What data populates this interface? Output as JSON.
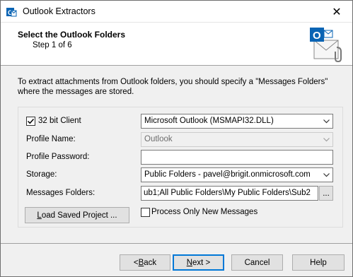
{
  "window": {
    "title": "Outlook Extractors",
    "app_icon": "outlook-extractor-icon",
    "close_glyph": "✕"
  },
  "header": {
    "title": "Select the Outlook Folders",
    "subtitle": "Step 1 of 6",
    "logo": "outlook-mail-logo"
  },
  "description": "To extract attachments from Outlook folders, you should specify a \"Messages Folders\" where the messages are stored.",
  "form": {
    "client_checkbox": {
      "label": "32 bit Client",
      "checked": true
    },
    "client_select": {
      "value": "Microsoft Outlook (MSMAPI32.DLL)"
    },
    "profile_name": {
      "label": "Profile Name:",
      "value": "Outlook"
    },
    "profile_password": {
      "label": "Profile Password:",
      "value": ""
    },
    "storage": {
      "label": "Storage:",
      "value": "Public Folders - pavel@brigit.onmicrosoft.com"
    },
    "messages_folders": {
      "label": "Messages Folders:",
      "value": "ub1;All Public Folders\\My Public Folders\\Sub2",
      "browse_label": "..."
    },
    "load_button": {
      "label": "Load Saved Project ...",
      "accel": "L",
      "rest": "oad Saved Project ..."
    },
    "process_new": {
      "label": "Process Only New Messages",
      "checked": false
    }
  },
  "footer": {
    "back": {
      "prefix": "< ",
      "accel": "B",
      "rest": "ack"
    },
    "next": {
      "accel": "N",
      "rest": "ext >"
    },
    "cancel": {
      "label": "Cancel"
    },
    "help": {
      "label": "Help"
    }
  },
  "colors": {
    "accent": "#0078d7",
    "outlook_blue": "#0a64b4"
  }
}
